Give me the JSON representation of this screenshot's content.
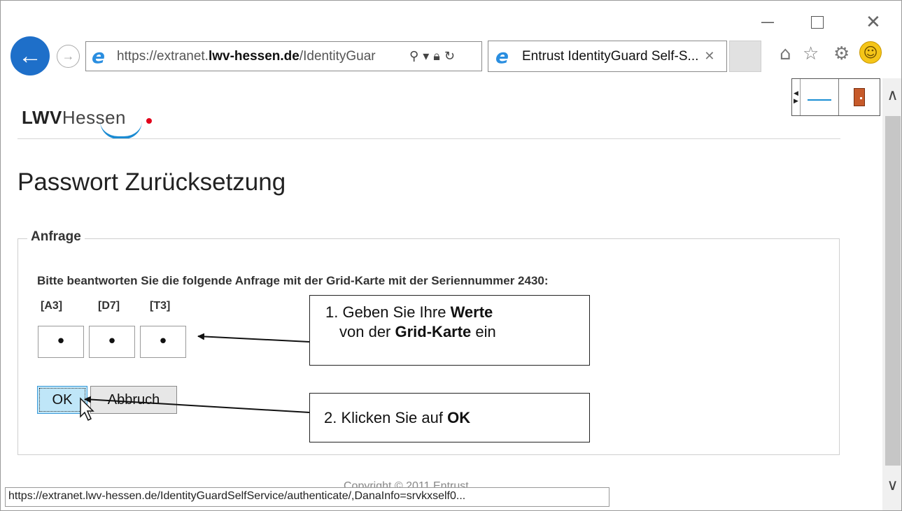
{
  "window": {
    "minimize": "—",
    "close": "✕"
  },
  "toolbar": {
    "address_prefix": "https://extranet.",
    "address_domain": "lwv-hessen.de",
    "address_suffix": "/IdentityGuar",
    "tab_title": "Entrust IdentityGuard Self-S...",
    "tab_close": "✕"
  },
  "icons": {
    "back": "back-arrow-icon",
    "forward": "forward-arrow-icon",
    "ie": "internet-explorer-icon",
    "search": "search-icon",
    "lock": "lock-icon",
    "refresh": "refresh-icon",
    "home": "home-icon",
    "favorites": "star-icon",
    "settings": "gear-icon",
    "feedback": "smiley-icon"
  },
  "page": {
    "logo_bold": "LWV",
    "logo_regular": "Hessen",
    "title": "Passwort Zurücksetzung",
    "section_legend": "Anfrage",
    "prompt": "Bitte beantworten Sie die folgende Anfrage mit der Grid-Karte mit der Seriennummer 2430:",
    "cells": [
      {
        "label": "[A3]",
        "value": "•"
      },
      {
        "label": "[D7]",
        "value": "•"
      },
      {
        "label": "[T3]",
        "value": "•"
      }
    ],
    "ok_label": "OK",
    "cancel_label": "Abbruch",
    "footer": "Copyright © 2011 Entrust"
  },
  "callouts": {
    "step1_prefix": "1. Geben Sie Ihre ",
    "step1_bold1": "Werte",
    "step1_line2_prefix": "von der ",
    "step1_bold2": "Grid-Karte",
    "step1_line2_suffix": " ein",
    "step2_prefix": "2. Klicken Sie auf ",
    "step2_bold": "OK"
  },
  "status_bar": {
    "url": "https://extranet.lwv-hessen.de/IdentityGuardSelfService/authenticate/,DanaInfo=srvkxself0..."
  },
  "colors": {
    "back_button": "#1e6fc9",
    "ok_button": "#bfe6f8",
    "logo_swoosh": "#1b8bd2",
    "logo_dot": "#e2001a"
  }
}
